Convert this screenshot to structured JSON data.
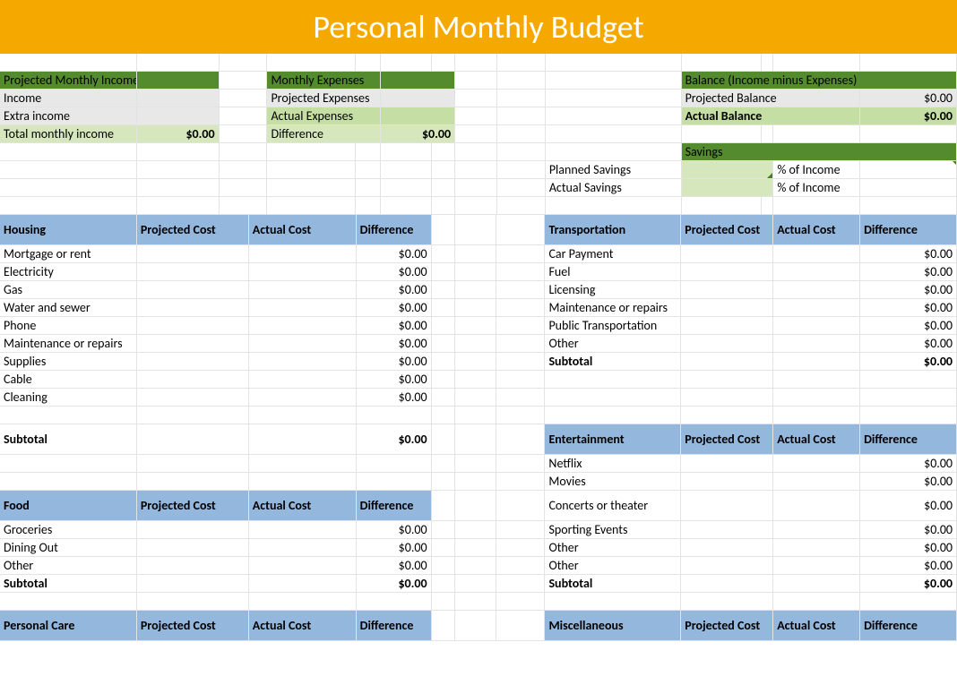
{
  "title": "Personal Monthly Budget",
  "hdr": {
    "pmi": "Projected Monthly Income",
    "me": "Monthly Expenses",
    "bal": "Balance (Income minus Expenses)",
    "sav": "Savings"
  },
  "inc": {
    "income": "Income",
    "extra": "Extra income",
    "total": "Total monthly income",
    "totalv": "$0.00"
  },
  "exp": {
    "proj": "Projected Expenses",
    "act": "Actual Expenses",
    "diff": "Difference",
    "diffv": "$0.00"
  },
  "bal": {
    "proj": "Projected Balance",
    "projv": "$0.00",
    "act": "Actual Balance",
    "actv": "$0.00"
  },
  "sav": {
    "plan": "Planned Savings",
    "act": "Actual Savings",
    "pct": "% of Income"
  },
  "cols": {
    "proj": "Projected Cost",
    "act": "Actual Cost",
    "diff": "Difference"
  },
  "cats": {
    "hous": "Housing",
    "food": "Food",
    "pers": "Personal Care",
    "trans": "Transportation",
    "ent": "Entertainment",
    "misc": "Miscellaneous"
  },
  "sub": "Subtotal",
  "z": "$0.00",
  "housItems": [
    "Mortgage or rent",
    "Electricity",
    "Gas",
    "Water and sewer",
    "Phone",
    "Maintenance or repairs",
    "Supplies",
    "Cable",
    "Cleaning"
  ],
  "foodItems": [
    "Groceries",
    "Dining Out",
    "Other"
  ],
  "transItems": [
    "Car Payment",
    "Fuel",
    "Licensing",
    "Maintenance or repairs",
    "Public Transportation",
    "Other"
  ],
  "entItems": [
    "Netflix",
    "Movies",
    "",
    "Concerts or theater",
    "",
    "Sporting Events",
    "Other",
    "Other"
  ]
}
